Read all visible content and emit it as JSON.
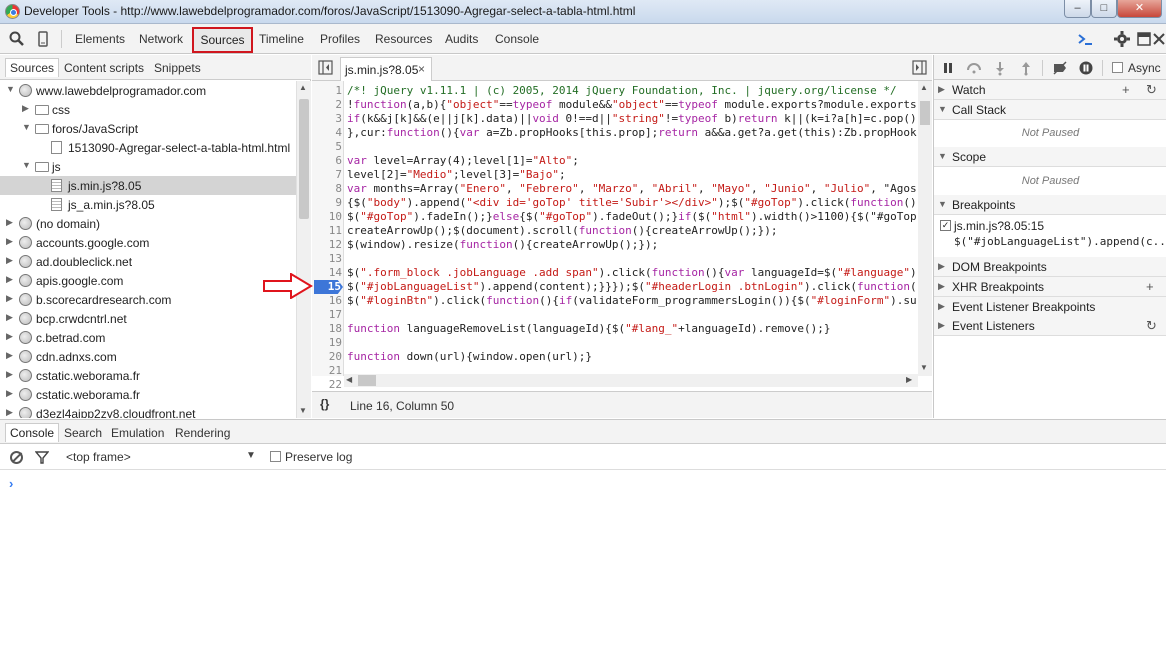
{
  "window": {
    "title": "Developer Tools - http://www.lawebdelprogramador.com/foros/JavaScript/1513090-Agregar-select-a-tabla-html.html",
    "min_glyph": "–",
    "max_glyph": "□",
    "close_glyph": "✕"
  },
  "toolbar": {
    "tabs": [
      "Elements",
      "Network",
      "Sources",
      "Timeline",
      "Profiles",
      "Resources",
      "Audits",
      "Console"
    ],
    "icons": [
      "search-icon",
      "device-mode-icon",
      "console-drawer-icon",
      "settings-icon",
      "dock-icon",
      "close-icon"
    ]
  },
  "navigator": {
    "tabs": [
      "Sources",
      "Content scripts",
      "Snippets"
    ],
    "tree": [
      {
        "label": "www.lawebdelprogramador.com",
        "depth": 0,
        "icon": "globe-icon",
        "expanded": true
      },
      {
        "label": "css",
        "depth": 1,
        "icon": "folder-icon",
        "expanded": false
      },
      {
        "label": "foros/JavaScript",
        "depth": 1,
        "icon": "folder-icon",
        "expanded": true
      },
      {
        "label": "1513090-Agregar-select-a-tabla-html.html",
        "depth": 2,
        "icon": "file-icon"
      },
      {
        "label": "js",
        "depth": 1,
        "icon": "folder-icon",
        "expanded": true
      },
      {
        "label": "js.min.js?8.05",
        "depth": 2,
        "icon": "js-file-icon",
        "selected": true
      },
      {
        "label": "js_a.min.js?8.05",
        "depth": 2,
        "icon": "js-file-icon"
      },
      {
        "label": "(no domain)",
        "depth": 0,
        "icon": "globe-icon",
        "expanded": false
      },
      {
        "label": "accounts.google.com",
        "depth": 0,
        "icon": "globe-icon",
        "expanded": false
      },
      {
        "label": "ad.doubleclick.net",
        "depth": 0,
        "icon": "globe-icon",
        "expanded": false
      },
      {
        "label": "apis.google.com",
        "depth": 0,
        "icon": "globe-icon",
        "expanded": false
      },
      {
        "label": "b.scorecardresearch.com",
        "depth": 0,
        "icon": "globe-icon",
        "expanded": false
      },
      {
        "label": "bcp.crwdcntrl.net",
        "depth": 0,
        "icon": "globe-icon",
        "expanded": false
      },
      {
        "label": "c.betrad.com",
        "depth": 0,
        "icon": "globe-icon",
        "expanded": false
      },
      {
        "label": "cdn.adnxs.com",
        "depth": 0,
        "icon": "globe-icon",
        "expanded": false
      },
      {
        "label": "cstatic.weborama.fr",
        "depth": 0,
        "icon": "globe-icon",
        "expanded": false
      },
      {
        "label": "cstatic.weborama.fr",
        "depth": 0,
        "icon": "globe-icon",
        "expanded": false
      },
      {
        "label": "d3ezl4ajpp2zy8.cloudfront.net",
        "depth": 0,
        "icon": "globe-icon",
        "expanded": false
      }
    ]
  },
  "editor": {
    "open_tab": "js.min.js?8.05",
    "close_glyph": "×",
    "breakpoint_line": 15,
    "lines": [
      "/*! jQuery v1.11.1 | (c) 2005, 2014 jQuery Foundation, Inc. | jquery.org/license */",
      "!function(a,b){\"object\"==typeof module&&\"object\"==typeof module.exports?module.exports",
      "if(k&&j[k]&&(e||j[k].data)||void 0!==d||\"string\"!=typeof b)return k||(k=i?a[h]=c.pop()",
      "},cur:function(){var a=Zb.propHooks[this.prop];return a&&a.get?a.get(this):Zb.propHook",
      "",
      "var level=Array(4);level[1]=\"Alto\";",
      "level[2]=\"Medio\";level[3]=\"Bajo\";",
      "var months=Array(\"Enero\", \"Febrero\", \"Marzo\", \"Abril\", \"Mayo\", \"Junio\", \"Julio\", \"Agos",
      "{$(\"body\").append(\"<div id='goTop' title='Subir'></div>\");$(\"#goTop\").click(function()",
      "$(\"#goTop\").fadeIn();}else{$(\"#goTop\").fadeOut();}if($(\"html\").width()>1100){$(\"#goTop",
      "createArrowUp();$(document).scroll(function(){createArrowUp();});",
      "$(window).resize(function(){createArrowUp();});",
      "",
      "$(\".form_block .jobLanguage .add span\").click(function(){var languageId=$(\"#language\")",
      "$(\"#jobLanguageList\").append(content);}}});$(\"#headerLogin .btnLogin\").click(function()",
      "$(\"#loginBtn\").click(function(){if(validateForm_programmersLogin()){$(\"#loginForm\").su",
      "",
      "function languageRemoveList(languageId){$(\"#lang_\"+languageId).remove();}",
      "",
      "function down(url){window.open(url);}",
      "",
      ""
    ],
    "status": {
      "pretty_print": "{}",
      "position": "Line 16, Column 50"
    }
  },
  "sidebar": {
    "async_label": "Async",
    "panes": {
      "watch": "Watch",
      "call_stack": "Call Stack",
      "call_stack_body": "Not Paused",
      "scope": "Scope",
      "scope_body": "Not Paused",
      "breakpoints": "Breakpoints",
      "dom_breakpoints": "DOM Breakpoints",
      "xhr_breakpoints": "XHR Breakpoints",
      "event_listener_breakpoints": "Event Listener Breakpoints",
      "event_listeners": "Event Listeners"
    },
    "breakpoint": {
      "location": "js.min.js?8.05:15",
      "source": "$(\"#jobLanguageList\").append(c..."
    }
  },
  "drawer": {
    "tabs": [
      "Console",
      "Search",
      "Emulation",
      "Rendering"
    ],
    "frame": "<top frame>",
    "preserve_log": "Preserve log",
    "prompt": "›"
  },
  "colors": {
    "highlight": "#d0161e",
    "breakpoint": "#3d76d8",
    "string": "#c41a16",
    "comment": "#236e25"
  }
}
